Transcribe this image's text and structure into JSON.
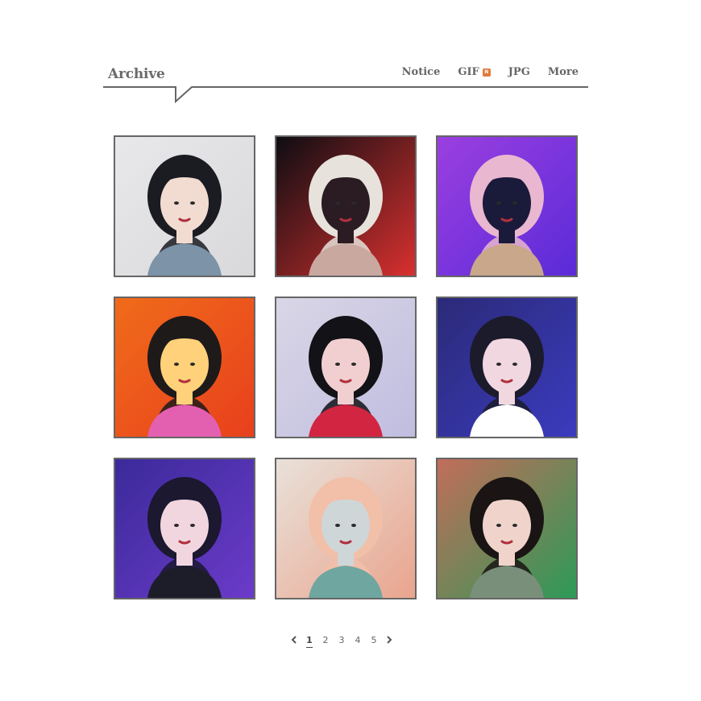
{
  "header": {
    "logo": "Archive",
    "nav": [
      {
        "label": "Notice"
      },
      {
        "label": "GIF",
        "badge": "N"
      },
      {
        "label": "JPG"
      },
      {
        "label": "More"
      }
    ]
  },
  "gallery": {
    "items": [
      {
        "alt": "photo-1",
        "palette": [
          "#e8e8ea",
          "#d9d9dc",
          "#1b1b22",
          "#f2dcd2",
          "#7c93a8"
        ]
      },
      {
        "alt": "photo-2",
        "palette": [
          "#0d0d12",
          "#d9302f",
          "#e7e2dc",
          "#2a1c22",
          "#c9a8a0"
        ]
      },
      {
        "alt": "photo-3",
        "palette": [
          "#9b3fe0",
          "#5a2bd8",
          "#e9b7d0",
          "#1a1a3a",
          "#c9a78a"
        ]
      },
      {
        "alt": "photo-4",
        "palette": [
          "#f06b1a",
          "#e8401d",
          "#1e1a1a",
          "#ffd17a",
          "#e35fb0"
        ]
      },
      {
        "alt": "photo-5",
        "palette": [
          "#d9d6e6",
          "#c0bde0",
          "#121217",
          "#f1cfd0",
          "#d12542"
        ]
      },
      {
        "alt": "photo-6",
        "palette": [
          "#2b2a78",
          "#3b3bbf",
          "#1b1b2c",
          "#f1d7e0",
          "#ffffff"
        ]
      },
      {
        "alt": "photo-7",
        "palette": [
          "#3b2a9a",
          "#6b3bc9",
          "#1b1830",
          "#f2d6df",
          "#1d1d2a"
        ]
      },
      {
        "alt": "photo-8",
        "palette": [
          "#e9e1da",
          "#e9a48d",
          "#f2bfa8",
          "#cfd6d8",
          "#6fa6a0"
        ]
      },
      {
        "alt": "photo-9",
        "palette": [
          "#c26d5a",
          "#2c9a57",
          "#1a1514",
          "#f0d4cc",
          "#7a8f7a"
        ]
      }
    ]
  },
  "pagination": {
    "pages": [
      "1",
      "2",
      "3",
      "4",
      "5"
    ],
    "current": "1",
    "prev_icon": "chevron-left-icon",
    "next_icon": "chevron-right-icon"
  }
}
